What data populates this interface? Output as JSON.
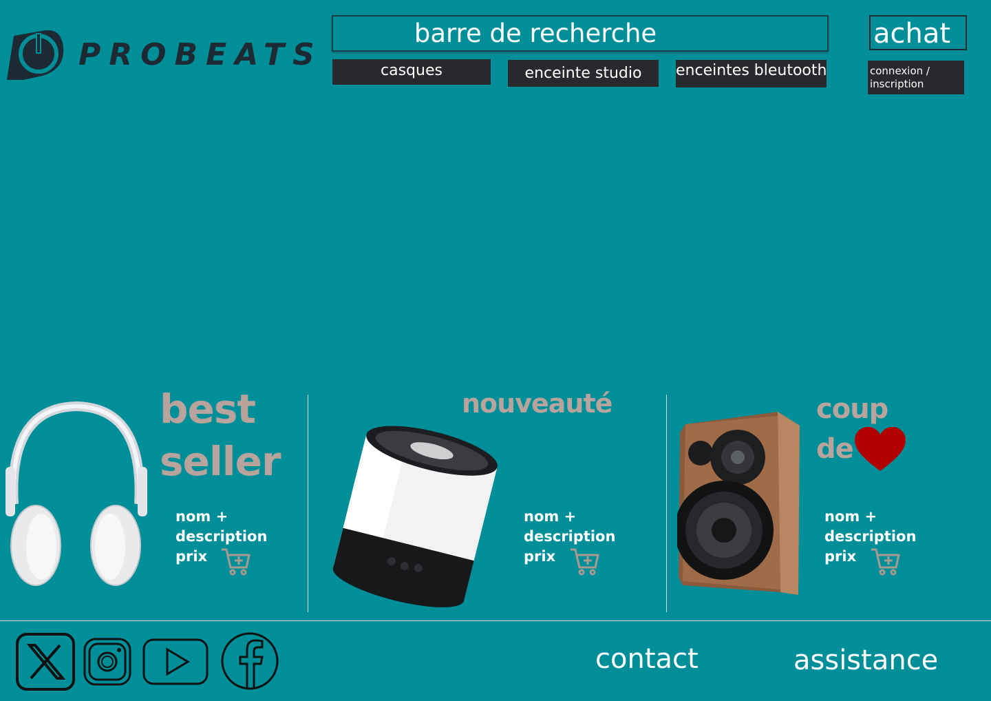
{
  "brand": {
    "name": "PROBEATS"
  },
  "header": {
    "search_label": "barre de recherche",
    "cart_label": "achat",
    "nav": [
      "casques",
      "enceinte studio",
      "enceintes bleutooth"
    ],
    "login_label": "connexion / inscription"
  },
  "products": [
    {
      "heading_line1": "best",
      "heading_line2": "seller",
      "desc_line1": "nom +",
      "desc_line2": "description",
      "desc_line3": "prix"
    },
    {
      "heading_line1": "nouveauté",
      "desc_line1": "nom +",
      "desc_line2": "description",
      "desc_line3": "prix"
    },
    {
      "heading_line1": "coup",
      "heading_line2": "de",
      "desc_line1": "nom +",
      "desc_line2": "description",
      "desc_line3": "prix"
    }
  ],
  "footer": {
    "social_icons": [
      "x-icon",
      "instagram-icon",
      "youtube-icon",
      "facebook-icon"
    ],
    "contact_label": "contact",
    "assistance_label": "assistance"
  },
  "colors": {
    "background": "#008f99",
    "nav_button": "#27292c",
    "heading": "#b8a49c",
    "heart": "#b00000"
  }
}
